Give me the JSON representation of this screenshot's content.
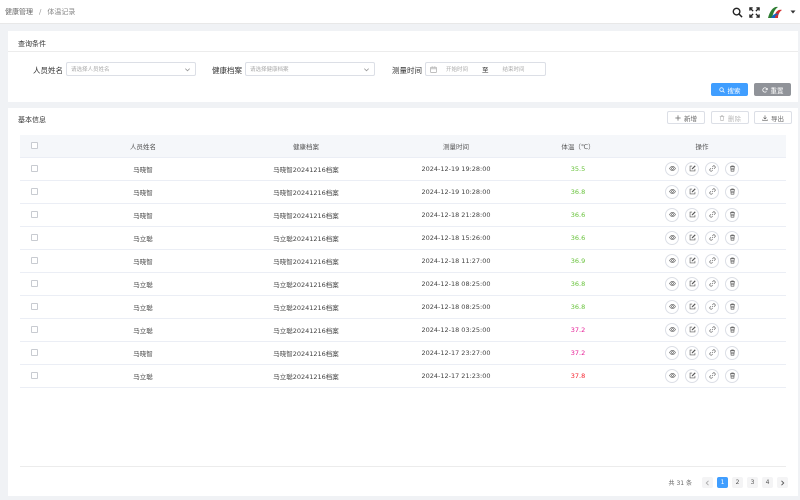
{
  "breadcrumb": {
    "parent": "健康管理",
    "separator": "/",
    "current": "体温记录"
  },
  "query": {
    "title": "查询条件",
    "person_label": "人员姓名",
    "person_placeholder": "请选择人员姓名",
    "archive_label": "健康档案",
    "archive_placeholder": "请选择健康档案",
    "time_label": "测量时间",
    "start_placeholder": "开始时间",
    "range_sep": "至",
    "end_placeholder": "结束时间",
    "search_label": "搜索",
    "reset_label": "重置"
  },
  "main": {
    "title": "基本信息",
    "add_label": "新增",
    "delete_label": "删除",
    "export_label": "导出"
  },
  "table": {
    "headers": [
      "人员姓名",
      "健康档案",
      "测量时间",
      "体温（℃）",
      "操作"
    ],
    "rows": [
      {
        "name": "马晓智",
        "archive": "马晓智20241216档案",
        "time": "2024-12-19 19:28:00",
        "temp": "35.5",
        "level": "normal"
      },
      {
        "name": "马晓智",
        "archive": "马晓智20241216档案",
        "time": "2024-12-19 10:28:00",
        "temp": "36.8",
        "level": "normal"
      },
      {
        "name": "马晓智",
        "archive": "马晓智20241216档案",
        "time": "2024-12-18 21:28:00",
        "temp": "36.6",
        "level": "normal"
      },
      {
        "name": "马立聪",
        "archive": "马立聪20241216档案",
        "time": "2024-12-18 15:26:00",
        "temp": "36.6",
        "level": "normal"
      },
      {
        "name": "马晓智",
        "archive": "马晓智20241216档案",
        "time": "2024-12-18 11:27:00",
        "temp": "36.9",
        "level": "normal"
      },
      {
        "name": "马立聪",
        "archive": "马立聪20241216档案",
        "time": "2024-12-18 08:25:00",
        "temp": "36.8",
        "level": "normal"
      },
      {
        "name": "马立聪",
        "archive": "马立聪20241216档案",
        "time": "2024-12-18 08:25:00",
        "temp": "36.8",
        "level": "normal"
      },
      {
        "name": "马立聪",
        "archive": "马立聪20241216档案",
        "time": "2024-12-18 03:25:00",
        "temp": "37.2",
        "level": "high"
      },
      {
        "name": "马晓智",
        "archive": "马晓智20241216档案",
        "time": "2024-12-17 23:27:00",
        "temp": "37.2",
        "level": "high"
      },
      {
        "name": "马立聪",
        "archive": "马立聪20241216档案",
        "time": "2024-12-17 21:23:00",
        "temp": "37.8",
        "level": "fever"
      }
    ]
  },
  "pagination": {
    "total_text": "共 31 条",
    "pages": [
      "1",
      "2",
      "3",
      "4"
    ],
    "current": "1"
  },
  "colors": {
    "primary": "#409eff",
    "reset": "#909399",
    "normal": "#67c23a",
    "high": "#e61e96",
    "fever": "#f5222d"
  },
  "icons": {
    "row_actions": [
      "eye-icon",
      "edit-icon",
      "link-icon",
      "trash-icon"
    ]
  }
}
